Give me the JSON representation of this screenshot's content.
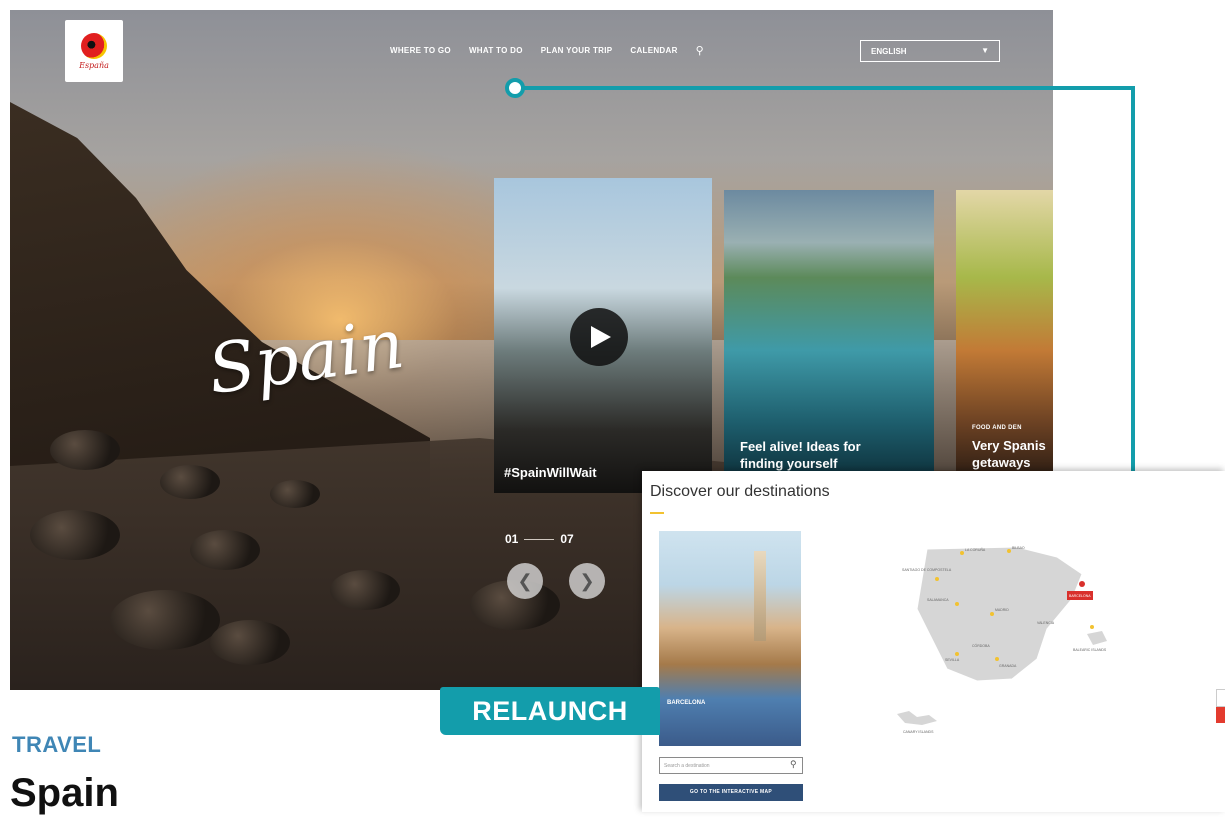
{
  "header": {
    "logo_text": "España",
    "nav": [
      "WHERE TO GO",
      "WHAT TO DO",
      "PLAN YOUR TRIP",
      "CALENDAR"
    ],
    "language": "ENGLISH"
  },
  "hero": {
    "title": "Spain",
    "counter_current": "01",
    "counter_total": "07"
  },
  "cards": [
    {
      "kicker": "",
      "title": "#SpainWillWait"
    },
    {
      "kicker": "",
      "title": "Feel alive! Ideas for finding yourself"
    },
    {
      "kicker": "FOOD AND DEN",
      "title": "Very Spanis getaways"
    }
  ],
  "destinations": {
    "title": "Discover our destinations",
    "city_name": "BARCELONA",
    "city_sub": "",
    "search_placeholder": "Search a destination",
    "button": "GO TO THE INTERACTIVE MAP"
  },
  "map_labels": [
    "LA CORUÑA",
    "BILBAO",
    "SANTIAGO DE COMPOSTELA",
    "SALAMANCA",
    "MADRID",
    "BARCELONA",
    "BALEARIC ISLANDS",
    "SEVILLA",
    "GRANADA",
    "CANARY ISLANDS",
    "VALENCIA",
    "CÓRDOBA"
  ],
  "article": {
    "badge": "RELAUNCH",
    "category": "TRAVEL",
    "headline": "Spain"
  },
  "colors": {
    "accent": "#139dab",
    "category": "#3f86b5",
    "button": "#2f4f78"
  }
}
